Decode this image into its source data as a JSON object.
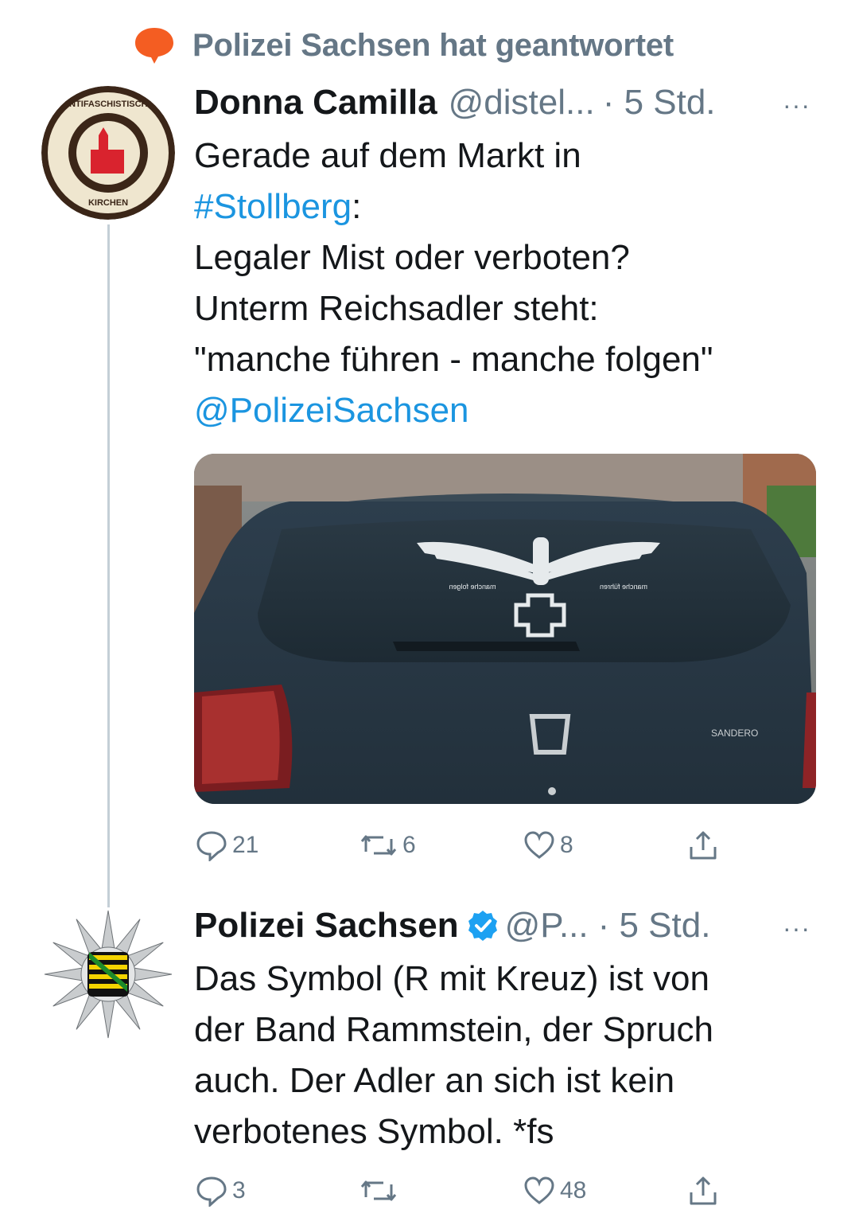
{
  "reply_indicator": {
    "text": "Polizei Sachsen hat geantwortet",
    "icon": "speech-bubble-icon",
    "color": "#f45d22"
  },
  "tweet1": {
    "author_name": "Donna Camilla",
    "handle": "@distel...",
    "time": "· 5 Std.",
    "more": "···",
    "avatar_text_top": "ANTIFASCHISTISCHE",
    "avatar_text_bottom": "KIRCHEN",
    "text_line1": "Gerade auf dem Markt in",
    "hashtag": "#Stollberg",
    "hashtag_suffix": ":",
    "text_line3": "Legaler Mist oder verboten?",
    "text_line4": "Unterm Reichsadler steht:",
    "text_line5": "\"manche führen - manche folgen\"",
    "mention": "@PolizeiSachsen",
    "replies": "21",
    "retweets": "6",
    "likes": "8",
    "sticker_text_left": "manche folgen",
    "sticker_text_right": "manche führen",
    "car_badge": "SANDERO"
  },
  "tweet2": {
    "author_name": "Polizei Sachsen",
    "handle": "@P...",
    "time": "· 5 Std.",
    "more": "···",
    "verified_color": "#1da1f2",
    "text_line1": "Das Symbol (R mit Kreuz) ist von",
    "text_line2": "der Band Rammstein, der Spruch",
    "text_line3": "auch. Der Adler an sich ist kein",
    "text_line4": "verbotenes Symbol. *fs",
    "replies": "3",
    "retweets": "",
    "likes": "48"
  },
  "colors": {
    "link": "#1b95e0",
    "secondary": "#657786",
    "thread_line": "#c4cfd6"
  }
}
